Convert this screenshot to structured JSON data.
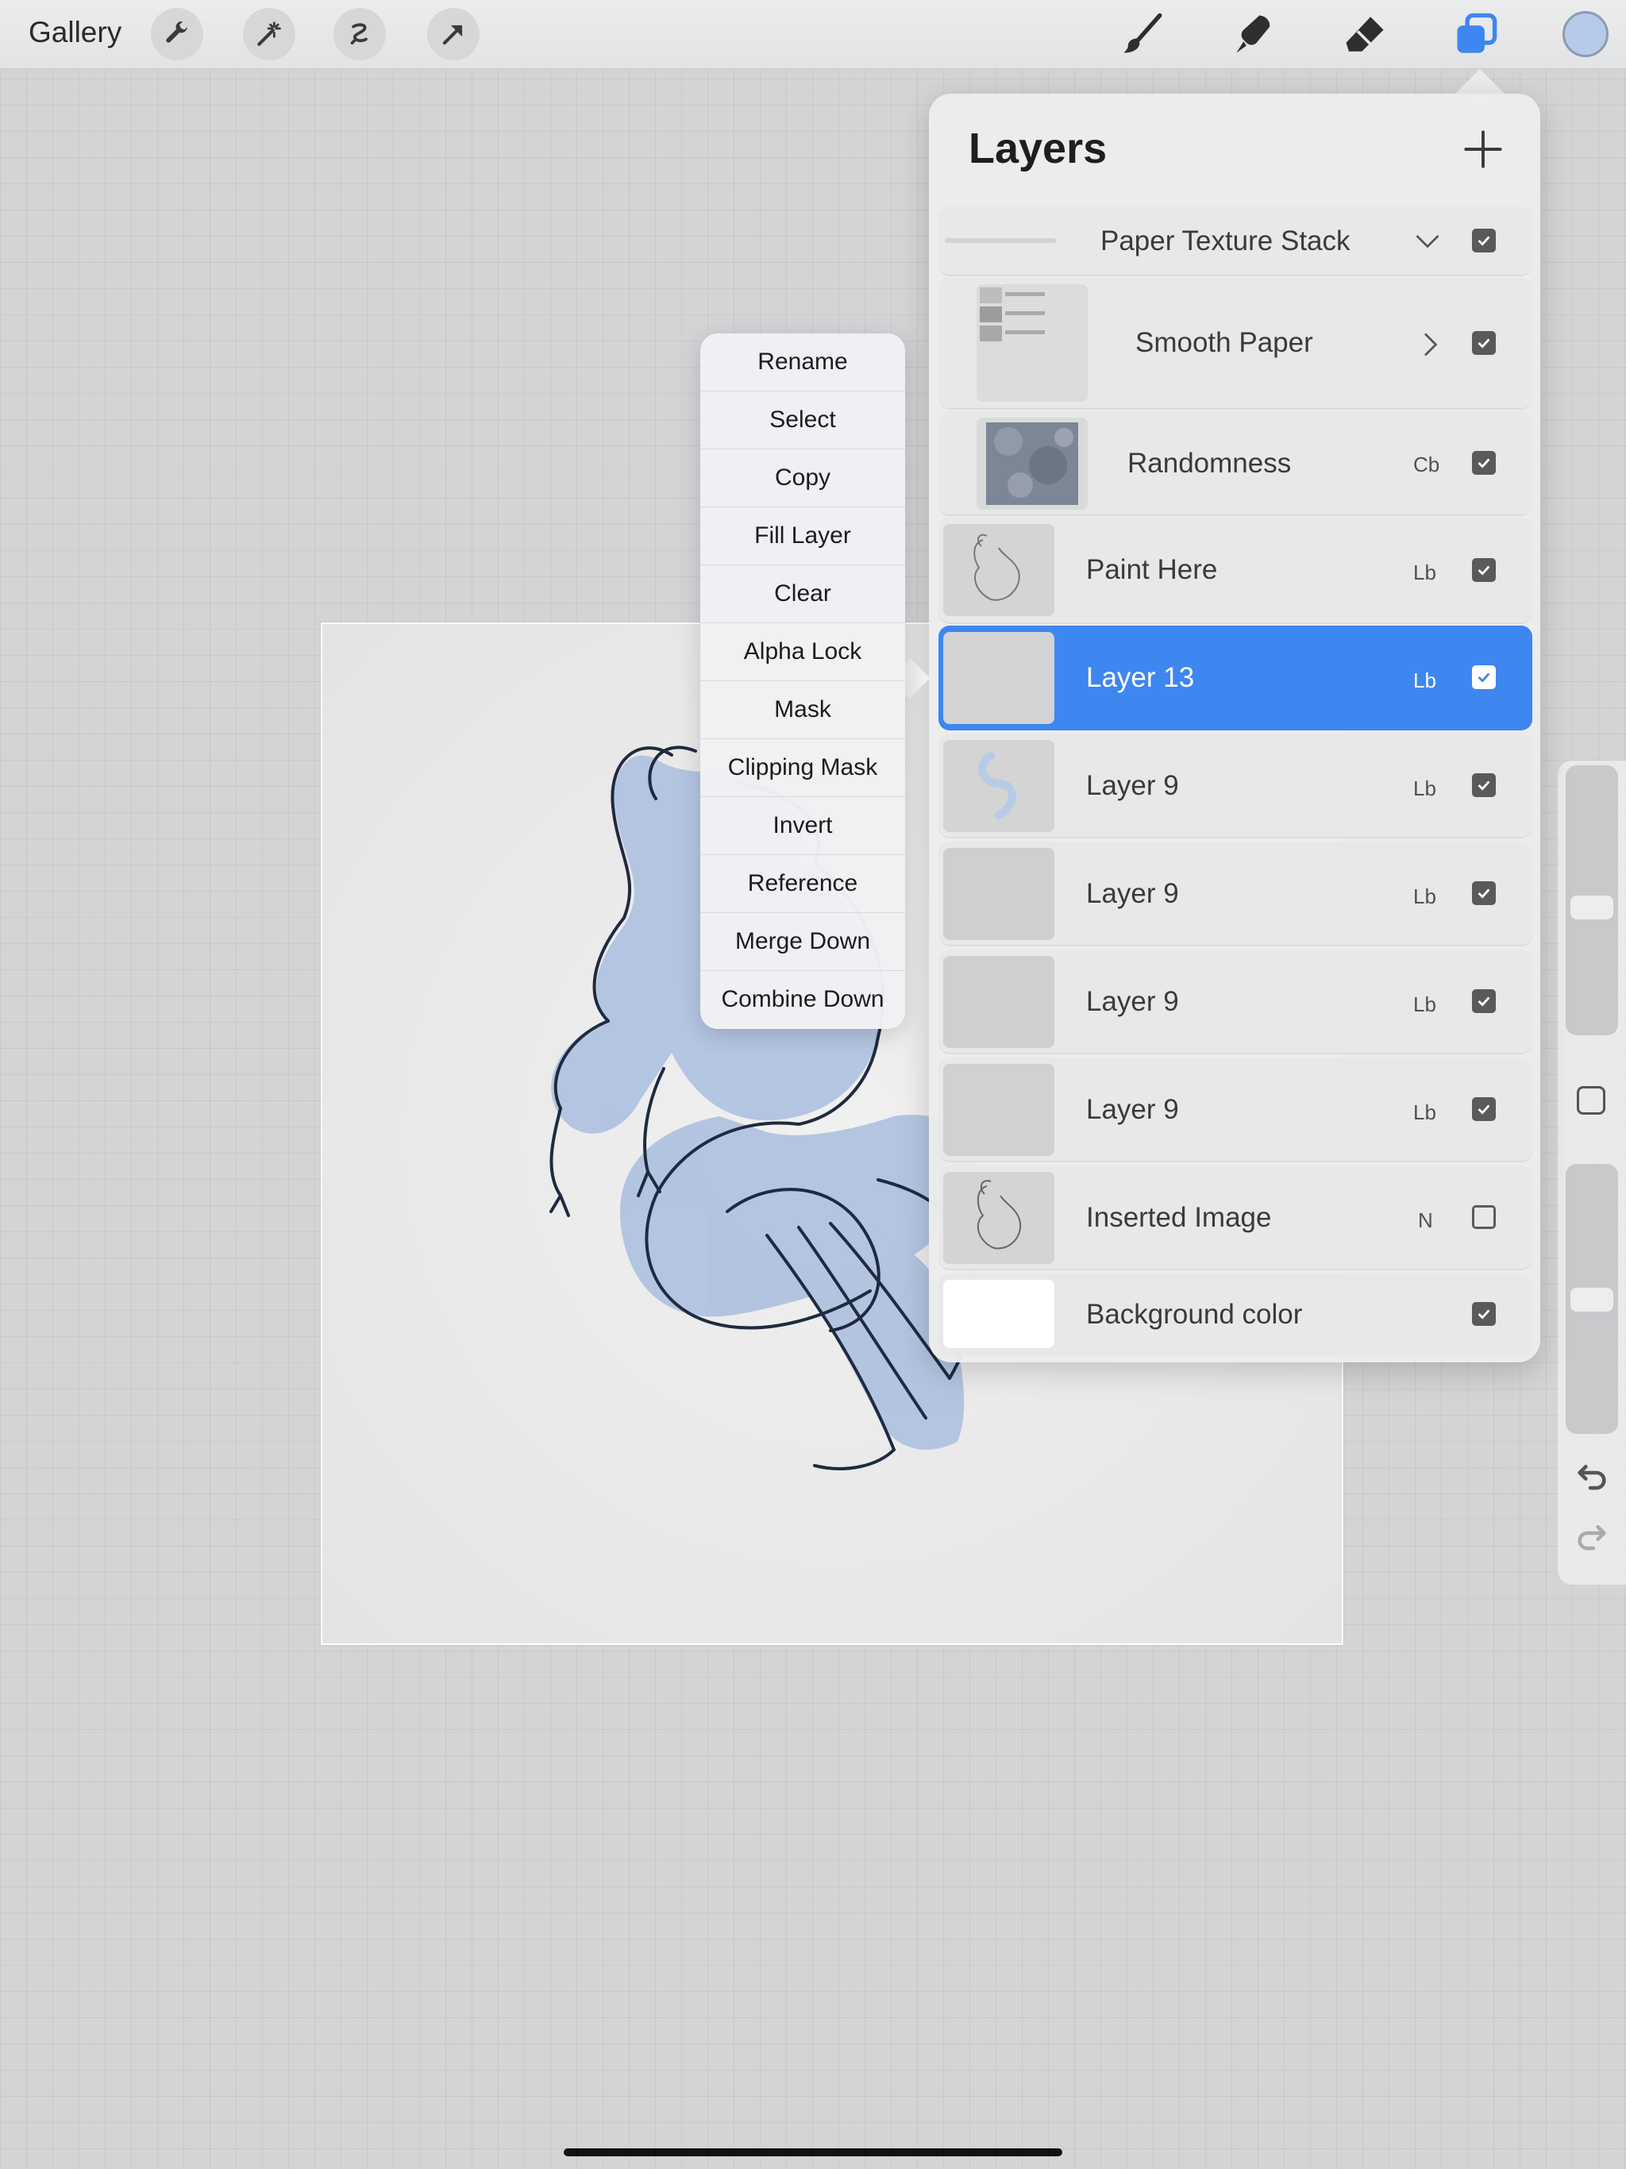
{
  "toolbar": {
    "gallery_label": "Gallery",
    "left_tools": [
      {
        "icon": "wrench-icon"
      },
      {
        "icon": "magic-wand-icon"
      },
      {
        "icon": "selection-icon"
      },
      {
        "icon": "transform-arrow-icon"
      }
    ],
    "right_tools": [
      {
        "icon": "brush-icon"
      },
      {
        "icon": "smudge-icon"
      },
      {
        "icon": "eraser-icon"
      },
      {
        "icon": "layers-icon",
        "active": true
      }
    ],
    "color_swatch": "#b6cbe9",
    "accent": "#3e86f0"
  },
  "layers_panel": {
    "title": "Layers",
    "add_icon": "plus-icon",
    "layers": [
      {
        "name": "Paper Texture Stack",
        "blend": "",
        "checked": true,
        "chevron": "down",
        "kind": "group"
      },
      {
        "name": "Smooth Paper",
        "blend": "",
        "checked": true,
        "chevron": "right",
        "kind": "group-child"
      },
      {
        "name": "Randomness",
        "blend": "Cb",
        "checked": true,
        "kind": "texture"
      },
      {
        "name": "Paint Here",
        "blend": "Lb",
        "checked": true,
        "kind": "sketch"
      },
      {
        "name": "Layer 13",
        "blend": "Lb",
        "checked": true,
        "selected": true,
        "kind": "blank"
      },
      {
        "name": "Layer 9",
        "blend": "Lb",
        "checked": true,
        "kind": "blue"
      },
      {
        "name": "Layer 9",
        "blend": "Lb",
        "checked": true,
        "kind": "blank"
      },
      {
        "name": "Layer 9",
        "blend": "Lb",
        "checked": true,
        "kind": "blank"
      },
      {
        "name": "Layer 9",
        "blend": "Lb",
        "checked": true,
        "kind": "blank"
      },
      {
        "name": "Inserted Image",
        "blend": "N",
        "checked": false,
        "kind": "sketch"
      },
      {
        "name": "Background color",
        "blend": "",
        "checked": true,
        "kind": "white"
      }
    ]
  },
  "context_menu": {
    "items": [
      "Rename",
      "Select",
      "Copy",
      "Fill Layer",
      "Clear",
      "Alpha Lock",
      "Mask",
      "Clipping Mask",
      "Invert",
      "Reference",
      "Merge Down",
      "Combine Down"
    ]
  },
  "sidebar": {
    "undo_icon": "undo-icon",
    "redo_icon": "redo-icon",
    "modify_icon": "square-icon"
  }
}
